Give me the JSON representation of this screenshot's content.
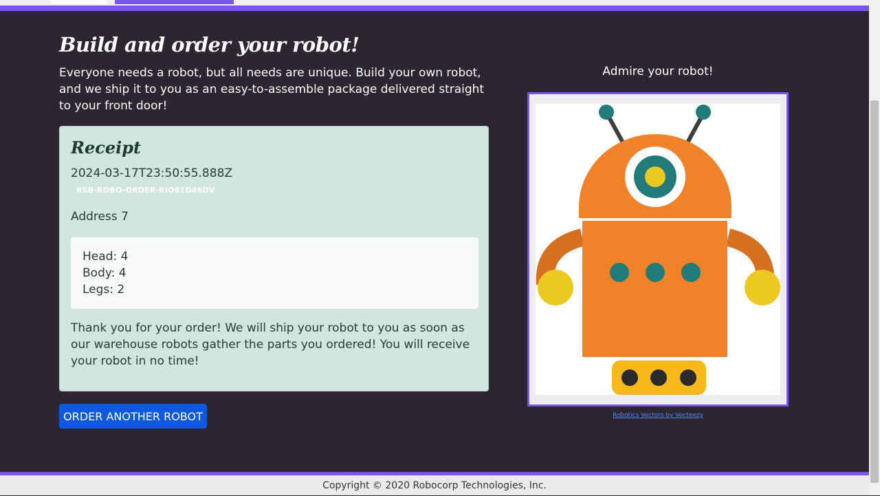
{
  "page": {
    "title": "Build and order your robot!",
    "intro": "Everyone needs a robot, but all needs are unique. Build your own robot, and we ship it to you as an easy-to-assemble package delivered straight to your front door!"
  },
  "receipt": {
    "heading": "Receipt",
    "timestamp": "2024-03-17T23:50:55.888Z",
    "order_id": "RSB-ROBO-ORDER-RIO81D46DV",
    "address": "Address 7",
    "parts": [
      "Head: 4",
      "Body: 4",
      "Legs: 2"
    ],
    "thanks": "Thank you for your order! We will ship your robot to you as soon as our warehouse robots gather the parts you ordered! You will receive your robot in no time!"
  },
  "order_button": {
    "label": "ORDER ANOTHER ROBOT"
  },
  "preview": {
    "heading": "Admire your robot!",
    "credit": "Robotics Vectors by Vecteezy"
  },
  "footer": {
    "copyright": "Copyright © 2020 Robocorp Technologies, Inc."
  },
  "colors": {
    "accent": "#7855ec",
    "background": "#2d2630",
    "receipt_bg": "#d1e6dd",
    "button": "#0d5ae0",
    "robot_orange": "#f0822a",
    "robot_teal": "#227b78",
    "robot_yellow": "#ecc823"
  }
}
